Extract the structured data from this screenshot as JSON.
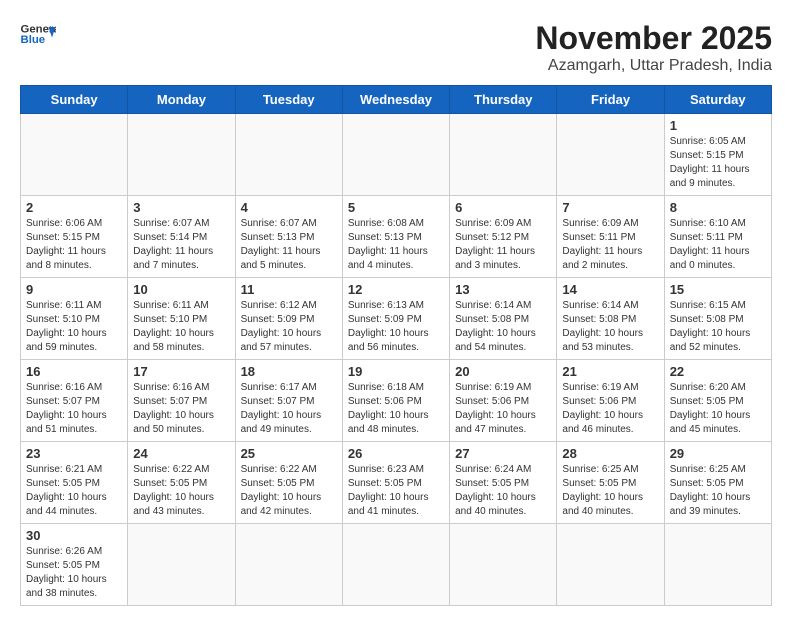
{
  "header": {
    "logo_general": "General",
    "logo_blue": "Blue",
    "title": "November 2025",
    "subtitle": "Azamgarh, Uttar Pradesh, India"
  },
  "weekdays": [
    "Sunday",
    "Monday",
    "Tuesday",
    "Wednesday",
    "Thursday",
    "Friday",
    "Saturday"
  ],
  "days": {
    "1": {
      "sunrise": "6:05 AM",
      "sunset": "5:15 PM",
      "daylight": "11 hours and 9 minutes."
    },
    "2": {
      "sunrise": "6:06 AM",
      "sunset": "5:15 PM",
      "daylight": "11 hours and 8 minutes."
    },
    "3": {
      "sunrise": "6:07 AM",
      "sunset": "5:14 PM",
      "daylight": "11 hours and 7 minutes."
    },
    "4": {
      "sunrise": "6:07 AM",
      "sunset": "5:13 PM",
      "daylight": "11 hours and 5 minutes."
    },
    "5": {
      "sunrise": "6:08 AM",
      "sunset": "5:13 PM",
      "daylight": "11 hours and 4 minutes."
    },
    "6": {
      "sunrise": "6:09 AM",
      "sunset": "5:12 PM",
      "daylight": "11 hours and 3 minutes."
    },
    "7": {
      "sunrise": "6:09 AM",
      "sunset": "5:11 PM",
      "daylight": "11 hours and 2 minutes."
    },
    "8": {
      "sunrise": "6:10 AM",
      "sunset": "5:11 PM",
      "daylight": "11 hours and 0 minutes."
    },
    "9": {
      "sunrise": "6:11 AM",
      "sunset": "5:10 PM",
      "daylight": "10 hours and 59 minutes."
    },
    "10": {
      "sunrise": "6:11 AM",
      "sunset": "5:10 PM",
      "daylight": "10 hours and 58 minutes."
    },
    "11": {
      "sunrise": "6:12 AM",
      "sunset": "5:09 PM",
      "daylight": "10 hours and 57 minutes."
    },
    "12": {
      "sunrise": "6:13 AM",
      "sunset": "5:09 PM",
      "daylight": "10 hours and 56 minutes."
    },
    "13": {
      "sunrise": "6:14 AM",
      "sunset": "5:08 PM",
      "daylight": "10 hours and 54 minutes."
    },
    "14": {
      "sunrise": "6:14 AM",
      "sunset": "5:08 PM",
      "daylight": "10 hours and 53 minutes."
    },
    "15": {
      "sunrise": "6:15 AM",
      "sunset": "5:08 PM",
      "daylight": "10 hours and 52 minutes."
    },
    "16": {
      "sunrise": "6:16 AM",
      "sunset": "5:07 PM",
      "daylight": "10 hours and 51 minutes."
    },
    "17": {
      "sunrise": "6:16 AM",
      "sunset": "5:07 PM",
      "daylight": "10 hours and 50 minutes."
    },
    "18": {
      "sunrise": "6:17 AM",
      "sunset": "5:07 PM",
      "daylight": "10 hours and 49 minutes."
    },
    "19": {
      "sunrise": "6:18 AM",
      "sunset": "5:06 PM",
      "daylight": "10 hours and 48 minutes."
    },
    "20": {
      "sunrise": "6:19 AM",
      "sunset": "5:06 PM",
      "daylight": "10 hours and 47 minutes."
    },
    "21": {
      "sunrise": "6:19 AM",
      "sunset": "5:06 PM",
      "daylight": "10 hours and 46 minutes."
    },
    "22": {
      "sunrise": "6:20 AM",
      "sunset": "5:05 PM",
      "daylight": "10 hours and 45 minutes."
    },
    "23": {
      "sunrise": "6:21 AM",
      "sunset": "5:05 PM",
      "daylight": "10 hours and 44 minutes."
    },
    "24": {
      "sunrise": "6:22 AM",
      "sunset": "5:05 PM",
      "daylight": "10 hours and 43 minutes."
    },
    "25": {
      "sunrise": "6:22 AM",
      "sunset": "5:05 PM",
      "daylight": "10 hours and 42 minutes."
    },
    "26": {
      "sunrise": "6:23 AM",
      "sunset": "5:05 PM",
      "daylight": "10 hours and 41 minutes."
    },
    "27": {
      "sunrise": "6:24 AM",
      "sunset": "5:05 PM",
      "daylight": "10 hours and 40 minutes."
    },
    "28": {
      "sunrise": "6:25 AM",
      "sunset": "5:05 PM",
      "daylight": "10 hours and 40 minutes."
    },
    "29": {
      "sunrise": "6:25 AM",
      "sunset": "5:05 PM",
      "daylight": "10 hours and 39 minutes."
    },
    "30": {
      "sunrise": "6:26 AM",
      "sunset": "5:05 PM",
      "daylight": "10 hours and 38 minutes."
    }
  }
}
